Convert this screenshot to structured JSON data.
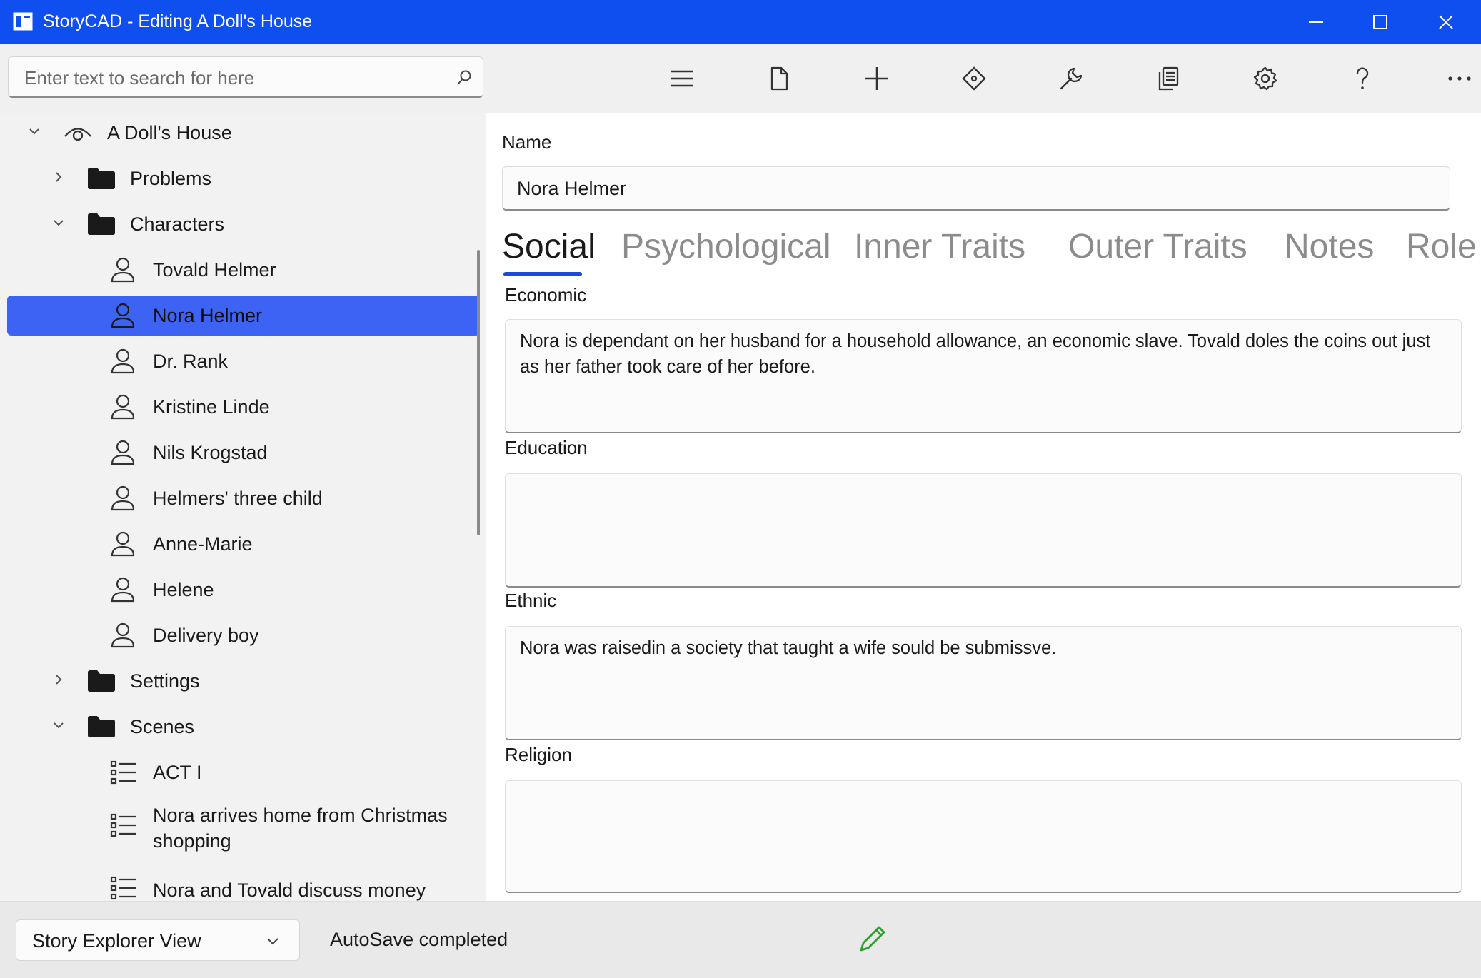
{
  "window": {
    "title": "StoryCAD - Editing A Doll's House"
  },
  "search": {
    "placeholder": "Enter text to search for here"
  },
  "toolbar": {
    "buttons": [
      {
        "icon": "hamburger-menu-icon"
      },
      {
        "icon": "file-icon"
      },
      {
        "icon": "add-icon"
      },
      {
        "icon": "move-icon"
      },
      {
        "icon": "wrench-icon"
      },
      {
        "icon": "copy-icon"
      },
      {
        "icon": "gear-icon"
      },
      {
        "icon": "help-icon"
      },
      {
        "icon": "more-icon"
      }
    ]
  },
  "tree": {
    "root": "A Doll's House",
    "items": [
      {
        "label": "Problems"
      },
      {
        "label": "Characters"
      },
      {
        "label": "Tovald Helmer"
      },
      {
        "label": "Nora Helmer",
        "selected": true
      },
      {
        "label": "Dr. Rank"
      },
      {
        "label": "Kristine Linde"
      },
      {
        "label": "Nils Krogstad"
      },
      {
        "label": "Helmers' three child"
      },
      {
        "label": "Anne-Marie"
      },
      {
        "label": "Helene"
      },
      {
        "label": "Delivery boy"
      },
      {
        "label": "Settings"
      },
      {
        "label": "Scenes"
      },
      {
        "label": "ACT I"
      },
      {
        "label": " Nora arrives home from Christmas shopping"
      },
      {
        "label": " Nora and Tovald discuss money"
      }
    ]
  },
  "editor": {
    "name_label": "Name",
    "name_value": "Nora Helmer",
    "tabs": [
      "Social",
      "Psychological",
      "Inner Traits",
      "Outer Traits",
      "Notes",
      "Role"
    ],
    "active_tab": "Social",
    "fields": [
      {
        "label": "Economic",
        "value": "Nora is dependant on her husband for a household allowance, an economic slave. Tovald doles the coins out just as her father took care of her before."
      },
      {
        "label": "Education",
        "value": ""
      },
      {
        "label": "Ethnic",
        "value": "Nora was raisedin a society that taught a wife sould be submissve."
      },
      {
        "label": "Religion",
        "value": ""
      }
    ]
  },
  "status": {
    "view_selector": "Story Explorer View",
    "message": "AutoSave completed",
    "accent": "#0f4ff0",
    "selection": "#3d63f5"
  }
}
